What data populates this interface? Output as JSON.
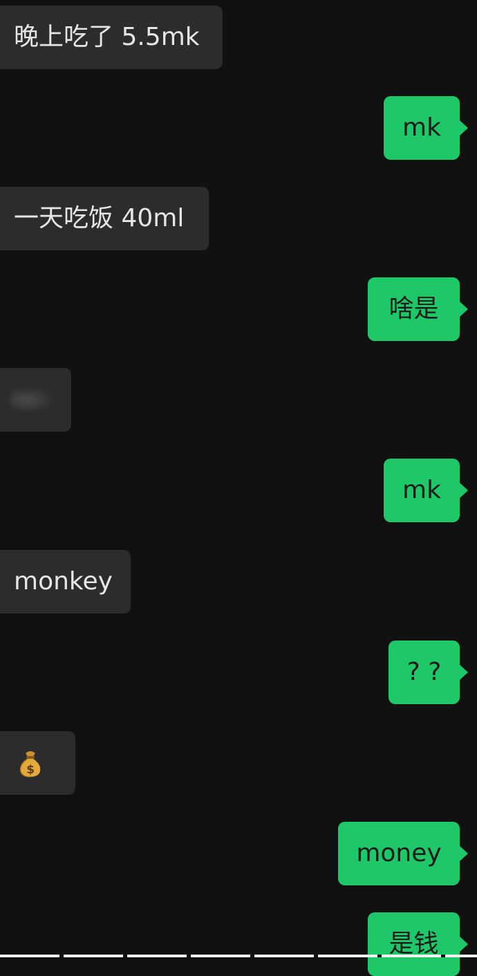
{
  "messages": [
    {
      "side": "in",
      "text": "晚上吃了 5.5mk"
    },
    {
      "side": "out",
      "text": "mk"
    },
    {
      "side": "in",
      "text": "一天吃饭 40ml"
    },
    {
      "side": "out",
      "text": "啥是"
    },
    {
      "side": "in",
      "sticker": "blurred-sticker"
    },
    {
      "side": "out",
      "text": "mk"
    },
    {
      "side": "in",
      "text": "monkey"
    },
    {
      "side": "out",
      "text": "? ?"
    },
    {
      "side": "in",
      "emoji": "money-bag-icon"
    },
    {
      "side": "out",
      "text": "money"
    },
    {
      "side": "out",
      "text": "是钱"
    }
  ],
  "colors": {
    "background": "#111111",
    "incoming_bubble": "#2c2c2c",
    "incoming_text": "#e6e6e6",
    "outgoing_bubble": "#1ec767",
    "outgoing_text": "#1b1b1b"
  }
}
